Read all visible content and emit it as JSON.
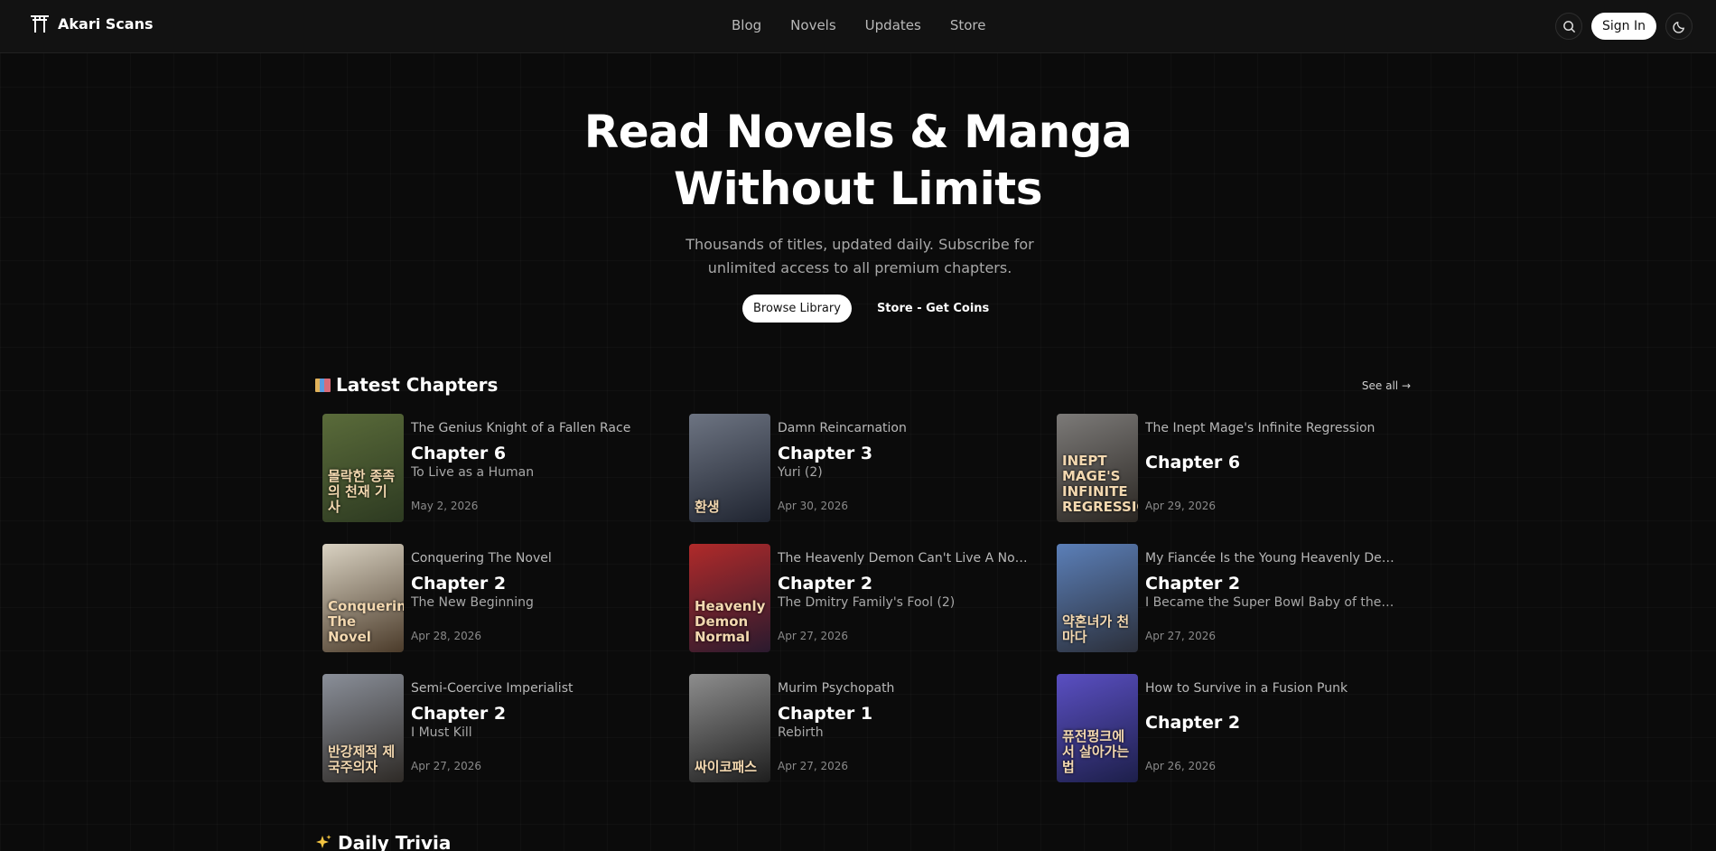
{
  "header": {
    "brand": "Akari Scans",
    "nav": [
      "Blog",
      "Novels",
      "Updates",
      "Store"
    ],
    "sign_in": "Sign In"
  },
  "hero": {
    "title_line1": "Read Novels & Manga",
    "title_line2": "Without Limits",
    "subtitle": "Thousands of titles, updated daily. Subscribe for unlimited access to all premium chapters.",
    "browse_label": "Browse Library",
    "store_label": "Store - Get Coins"
  },
  "latest": {
    "title": "Latest Chapters",
    "see_all": "See all →",
    "items": [
      {
        "series": "The Genius Knight of a Fallen Race",
        "chapter": "Chapter 6",
        "subtitle": "To Live as a Human",
        "date": "May 2, 2026",
        "cover_colors": [
          "#5a6b3a",
          "#2d3a21"
        ],
        "cover_text": "몰락한 종족의 천재 기사"
      },
      {
        "series": "Damn Reincarnation",
        "chapter": "Chapter 3",
        "subtitle": "Yuri (2)",
        "date": "Apr 30, 2026",
        "cover_colors": [
          "#6d7482",
          "#1f2430"
        ],
        "cover_text": "환생"
      },
      {
        "series": "The Inept Mage's Infinite Regression",
        "chapter": "Chapter 6",
        "subtitle": "",
        "date": "Apr 29, 2026",
        "cover_colors": [
          "#7c7a78",
          "#2a2622"
        ],
        "cover_text": "INEPT MAGE'S INFINITE REGRESSION"
      },
      {
        "series": "Conquering The Novel",
        "chapter": "Chapter 2",
        "subtitle": "The New Beginning",
        "date": "Apr 28, 2026",
        "cover_colors": [
          "#d9d2c2",
          "#4b3b2a"
        ],
        "cover_text": "Conquering The Novel"
      },
      {
        "series": "The Heavenly Demon Can't Live A Normal Life",
        "chapter": "Chapter 2",
        "subtitle": "The Dmitry Family's Fool (2)",
        "date": "Apr 27, 2026",
        "cover_colors": [
          "#b02a2a",
          "#2a1a2e"
        ],
        "cover_text": "Heavenly Demon Normal"
      },
      {
        "series": "My Fiancée Is the Young Heavenly Demon",
        "chapter": "Chapter 2",
        "subtitle": "I Became the Super Bowl Baby of the Martial World",
        "date": "Apr 27, 2026",
        "cover_colors": [
          "#5b7fb8",
          "#2b2f3a"
        ],
        "cover_text": "약혼녀가 천마다"
      },
      {
        "series": "Semi-Coercive Imperialist",
        "chapter": "Chapter 2",
        "subtitle": "I Must Kill",
        "date": "Apr 27, 2026",
        "cover_colors": [
          "#8a8f99",
          "#2e2a26"
        ],
        "cover_text": "반강제적 제국주의자"
      },
      {
        "series": "Murim Psychopath",
        "chapter": "Chapter 1",
        "subtitle": "Rebirth",
        "date": "Apr 27, 2026",
        "cover_colors": [
          "#8d8d8d",
          "#1e1e1e"
        ],
        "cover_text": "싸이코패스"
      },
      {
        "series": "How to Survive in a Fusion Punk",
        "chapter": "Chapter 2",
        "subtitle": "",
        "date": "Apr 26, 2026",
        "cover_colors": [
          "#5a4fc2",
          "#1d1f4a"
        ],
        "cover_text": "퓨전펑크에서 살아가는 법"
      }
    ]
  },
  "trivia": {
    "title": "Daily Trivia"
  }
}
